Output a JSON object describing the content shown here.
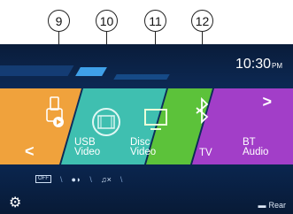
{
  "callouts": [
    "9",
    "10",
    "11",
    "12"
  ],
  "clock": {
    "time": "10:30",
    "ampm": "PM"
  },
  "tiles": [
    {
      "label_1": "USB",
      "label_2": "Video",
      "color": "#f0a23c",
      "icon": "usb-icon"
    },
    {
      "label_1": "Disc",
      "label_2": "Video",
      "color": "#3fbfb0",
      "icon": "disc-video-icon"
    },
    {
      "label_1": "TV",
      "label_2": "",
      "color": "#5cc23a",
      "icon": "tv-icon"
    },
    {
      "label_1": "BT",
      "label_2": "Audio",
      "color": "#a23ec8",
      "icon": "bluetooth-icon"
    }
  ],
  "nav": {
    "prev": "<",
    "next": ">"
  },
  "subbar": {
    "off_badge": "OFF",
    "clear_glyph": "♫×"
  },
  "bottom": {
    "rear_label": "Rear",
    "settings_icon": "gear-icon"
  }
}
